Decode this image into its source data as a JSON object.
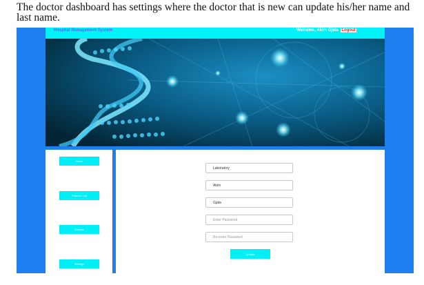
{
  "caption": "The doctor dashboard has settings where the doctor that is new can update his/her name and last name.",
  "header": {
    "system_title": "Hospital Management System",
    "welcome_label": "Welcome,",
    "user_name": "Akim Gjata",
    "logout_label": "Logout"
  },
  "sidebar": {
    "items": [
      {
        "label": "Home"
      },
      {
        "label": "Patients List"
      },
      {
        "label": "Results"
      },
      {
        "label": "Settings"
      }
    ]
  },
  "settings_form": {
    "department_value": "Laboratory",
    "first_name_value": "Akim",
    "last_name_value": "Gjata",
    "password_placeholder": "Enter Password",
    "reenter_password_placeholder": "Re-enter Password",
    "update_label": "Update"
  },
  "colors": {
    "frame": "#1e7ff0",
    "topbar": "#00f3f7",
    "button": "#00eef6",
    "logout": "#ff1a1a"
  }
}
